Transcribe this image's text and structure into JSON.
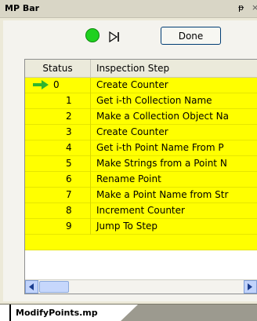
{
  "window": {
    "title": "MP Bar",
    "pin_glyph": "ᵽ",
    "close_glyph": "×"
  },
  "toolbar": {
    "done_label": "Done"
  },
  "grid": {
    "columns": [
      "Status",
      "Inspection Step"
    ],
    "current_index": 0,
    "rows": [
      {
        "status": "0",
        "step": "Create Counter"
      },
      {
        "status": "1",
        "step": "Get i-th Collection Name"
      },
      {
        "status": "2",
        "step": "Make a Collection Object Na"
      },
      {
        "status": "3",
        "step": "Create Counter"
      },
      {
        "status": "4",
        "step": "Get i-th Point Name From P"
      },
      {
        "status": "5",
        "step": "Make Strings from a Point N"
      },
      {
        "status": "6",
        "step": "Rename Point"
      },
      {
        "status": "7",
        "step": "Make a Point Name from Str"
      },
      {
        "status": "8",
        "step": "Increment Counter"
      },
      {
        "status": "9",
        "step": "Jump To Step"
      }
    ]
  },
  "tabs": [
    {
      "label": "ModifyPoints.mp"
    }
  ],
  "colors": {
    "row_bg": "#ffff00",
    "run_indicator": "#1fd11f",
    "current_arrow": "#2fb52f"
  }
}
